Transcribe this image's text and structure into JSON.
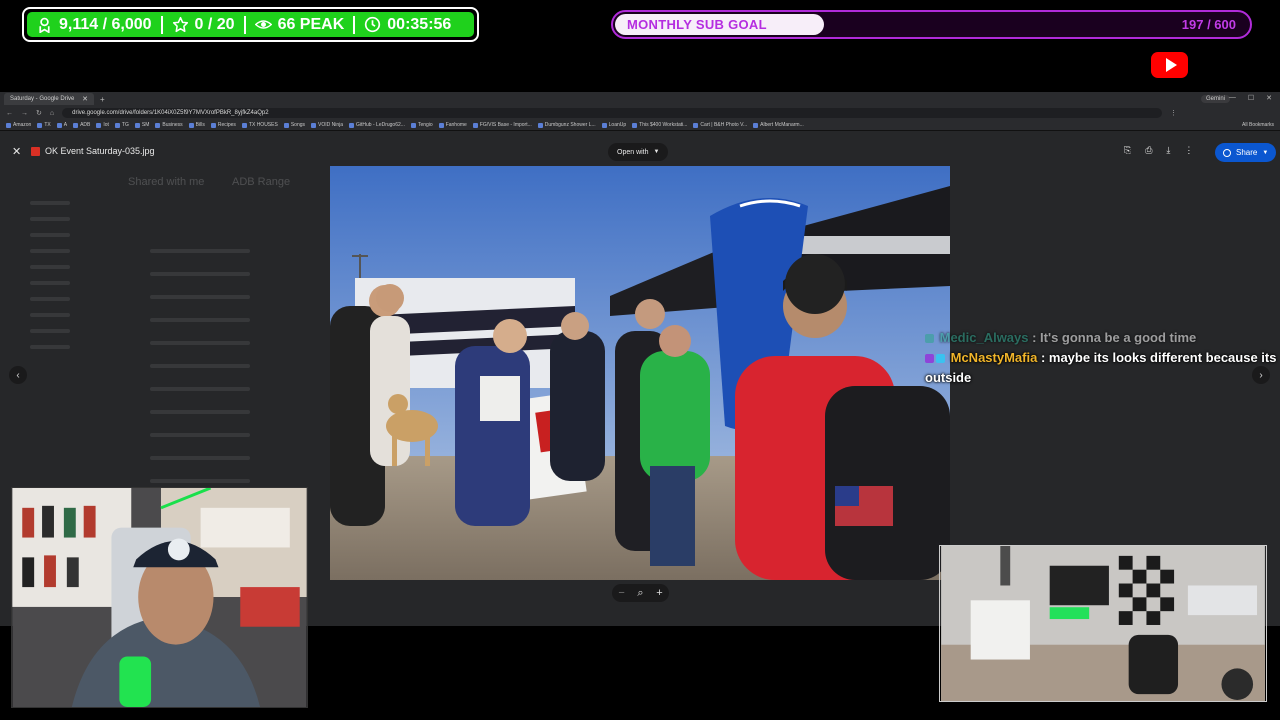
{
  "overlay": {
    "stats": {
      "followers": "9,114 / 6,000",
      "favorites": "0 / 20",
      "peak": "66 PEAK",
      "uptime": "00:35:56"
    },
    "sub_goal": {
      "label": "MONTHLY SUB GOAL",
      "count": "197 / 600",
      "progress": 0.33,
      "fill_color": "#f7eef9",
      "border_color": "#b02bd9"
    },
    "stats_color": "#1fd11c"
  },
  "browser": {
    "tab_title": "Saturday - Google Drive",
    "gemini_label": "Gemini",
    "url": "drive.google.com/drive/folders/1K04iX0Z5f9Y7MVXrofPBkR_8yjfkZ4aQp2",
    "bookmarks": [
      "Amazon",
      "TX",
      "A",
      "ADB",
      "Iot",
      "TG",
      "SM",
      "Business",
      "Bills",
      "Recipes",
      "TX HOUSES",
      "Songs",
      "VOID Ninja",
      "GitHub - LeDrugo62...",
      "Tengio",
      "Fanhome",
      "FG/VIS Base - Import...",
      "Dumbgunz Shower L...",
      "LoanUp",
      "This $400 Workstati...",
      "Cart | B&H Photo V...",
      "Albert McManarm..."
    ],
    "all_bookmarks": "All Bookmarks"
  },
  "viewer": {
    "file_name": "OK Event Saturday-035.jpg",
    "open_with": "Open with",
    "share": "Share",
    "zoom_out": "−",
    "zoom_in": "+",
    "folder_title_1": "Shared with me",
    "folder_title_2": "ADB Range"
  },
  "chat": [
    {
      "user": "Medic_Always",
      "message": " : It's gonna be a good time"
    },
    {
      "user": "McNastyMafia",
      "message": " : maybe its looks different because its outside"
    }
  ]
}
